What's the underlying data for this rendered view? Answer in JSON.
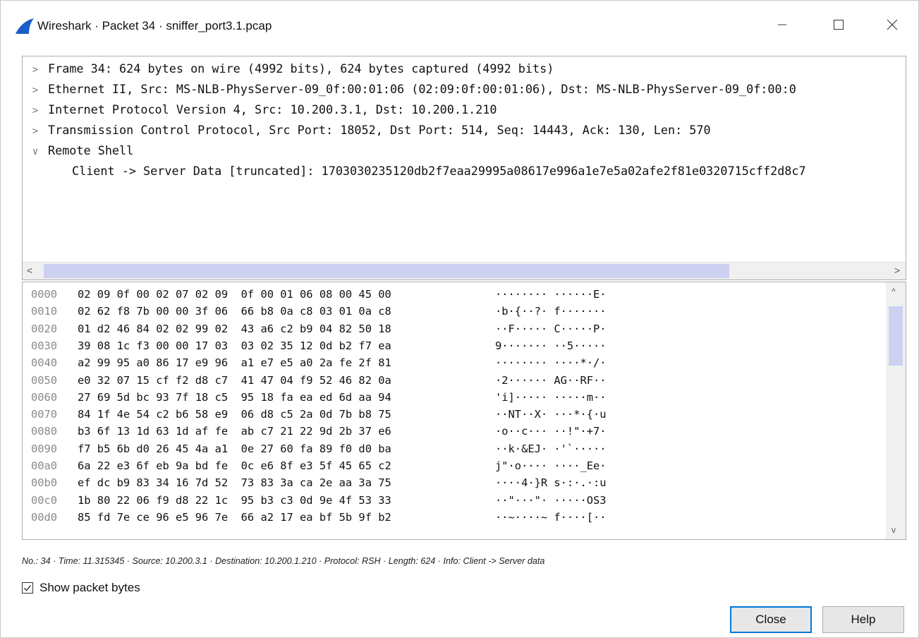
{
  "window": {
    "title": "Wireshark · Packet 34 · sniffer_port3.1.pcap",
    "controls": {
      "minimize_icon": "minimize-icon",
      "maximize_icon": "maximize-icon",
      "close_icon": "close-icon"
    }
  },
  "tree": {
    "rows": [
      {
        "arrow": ">",
        "text": "Frame 34: 624 bytes on wire (4992 bits), 624 bytes captured (4992 bits)"
      },
      {
        "arrow": ">",
        "text": "Ethernet II, Src: MS-NLB-PhysServer-09_0f:00:01:06 (02:09:0f:00:01:06), Dst: MS-NLB-PhysServer-09_0f:00:0"
      },
      {
        "arrow": ">",
        "text": "Internet Protocol Version 4, Src: 10.200.3.1, Dst: 10.200.1.210"
      },
      {
        "arrow": ">",
        "text": "Transmission Control Protocol, Src Port: 18052, Dst Port: 514, Seq: 14443, Ack: 130, Len: 570"
      },
      {
        "arrow": "v",
        "text": "Remote Shell"
      },
      {
        "arrow": "",
        "text": "Client -> Server Data [truncated]: 1703030235120db2f7eaa29995a08617e996a1e7e5a02afe2f81e0320715cff2d8c7"
      }
    ],
    "hscroll": {
      "left_arrow": "<",
      "right_arrow": ">"
    }
  },
  "hex": {
    "rows": [
      {
        "offset": "0000",
        "bytes": "02 09 0f 00 02 07 02 09  0f 00 01 06 08 00 45 00",
        "ascii": "········ ······E·"
      },
      {
        "offset": "0010",
        "bytes": "02 62 f8 7b 00 00 3f 06  66 b8 0a c8 03 01 0a c8",
        "ascii": "·b·{··?· f·······"
      },
      {
        "offset": "0020",
        "bytes": "01 d2 46 84 02 02 99 02  43 a6 c2 b9 04 82 50 18",
        "ascii": "··F····· C·····P·"
      },
      {
        "offset": "0030",
        "bytes": "39 08 1c f3 00 00 17 03  03 02 35 12 0d b2 f7 ea",
        "ascii": "9······· ··5·····"
      },
      {
        "offset": "0040",
        "bytes": "a2 99 95 a0 86 17 e9 96  a1 e7 e5 a0 2a fe 2f 81",
        "ascii": "········ ····*·/·"
      },
      {
        "offset": "0050",
        "bytes": "e0 32 07 15 cf f2 d8 c7  41 47 04 f9 52 46 82 0a",
        "ascii": "·2······ AG··RF··"
      },
      {
        "offset": "0060",
        "bytes": "27 69 5d bc 93 7f 18 c5  95 18 fa ea ed 6d aa 94",
        "ascii": "'i]····· ·····m··"
      },
      {
        "offset": "0070",
        "bytes": "84 1f 4e 54 c2 b6 58 e9  06 d8 c5 2a 0d 7b b8 75",
        "ascii": "··NT··X· ···*·{·u"
      },
      {
        "offset": "0080",
        "bytes": "b3 6f 13 1d 63 1d af fe  ab c7 21 22 9d 2b 37 e6",
        "ascii": "·o··c··· ··!\"·+7·"
      },
      {
        "offset": "0090",
        "bytes": "f7 b5 6b d0 26 45 4a a1  0e 27 60 fa 89 f0 d0 ba",
        "ascii": "··k·&EJ· ·'`·····"
      },
      {
        "offset": "00a0",
        "bytes": "6a 22 e3 6f eb 9a bd fe  0c e6 8f e3 5f 45 65 c2",
        "ascii": "j\"·o···· ····_Ee·"
      },
      {
        "offset": "00b0",
        "bytes": "ef dc b9 83 34 16 7d 52  73 83 3a ca 2e aa 3a 75",
        "ascii": "····4·}R s·:·.·:u"
      },
      {
        "offset": "00c0",
        "bytes": "1b 80 22 06 f9 d8 22 1c  95 b3 c3 0d 9e 4f 53 33",
        "ascii": "··\"···\"· ·····OS3"
      },
      {
        "offset": "00d0",
        "bytes": "85 fd 7e ce 96 e5 96 7e  66 a2 17 ea bf 5b 9f b2",
        "ascii": "··~····~ f····[··"
      }
    ],
    "vscroll": {
      "up_arrow": "^",
      "down_arrow": "v"
    }
  },
  "status_line": "No.: 34 · Time: 11.315345 · Source: 10.200.3.1 · Destination: 10.200.1.210 · Protocol: RSH · Length: 624 · Info: Client -> Server data",
  "show_packet_bytes": {
    "label": "Show packet bytes",
    "checked": true
  },
  "buttons": {
    "close": "Close",
    "help": "Help"
  },
  "colors": {
    "accent": "#0078d7",
    "scroll_thumb": "#cdd0f0",
    "offset_gray": "#8a8a8a"
  }
}
